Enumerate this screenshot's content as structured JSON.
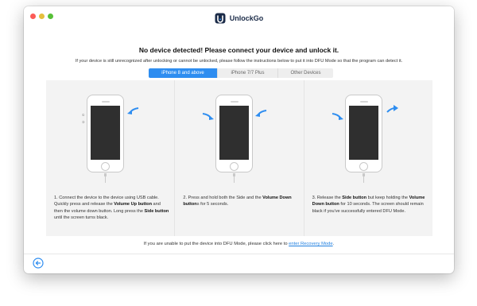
{
  "app": {
    "name": "UnlockGo"
  },
  "colors": {
    "accent": "#2e8df0",
    "link": "#1f7fe0",
    "arrow": "#2e8df0",
    "screen": "#2f2f2f"
  },
  "headline": "No device detected! Please connect your device and unlock it.",
  "subline": "If your device is still unrecognized after unlocking or cannot be unlocked, please follow the instructions below to put it into DFU Mode so that the program can detect it.",
  "tabs": [
    {
      "label": "iPhone 8 and above",
      "active": true
    },
    {
      "label": "iPhone 7/7 Plus",
      "active": false
    },
    {
      "label": "Other Devices",
      "active": false
    }
  ],
  "steps": [
    {
      "side_labels": [
        "①",
        "②"
      ],
      "arrows": [
        "right-arrow-icon"
      ],
      "parts": [
        {
          "t": "1. Connect the device to the device using USB cable. Quickly press and release the ",
          "b": false
        },
        {
          "t": "Volume Up button",
          "b": true
        },
        {
          "t": " and then the volume down button. Long press the ",
          "b": false
        },
        {
          "t": "Side button",
          "b": true
        },
        {
          "t": " until the screen turns black.",
          "b": false
        }
      ]
    },
    {
      "arrows": [
        "left-arrow-icon",
        "right-arrow-icon"
      ],
      "parts": [
        {
          "t": "2. Press and hold both the Side and the ",
          "b": false
        },
        {
          "t": "Volume Down button",
          "b": true
        },
        {
          "t": "s for 5 seconds.",
          "b": false
        }
      ]
    },
    {
      "arrows": [
        "left-arrow-icon",
        "release-arrow-icon"
      ],
      "parts": [
        {
          "t": "3. Release the ",
          "b": false
        },
        {
          "t": "Side button",
          "b": true
        },
        {
          "t": " but keep holding the ",
          "b": false
        },
        {
          "t": "Volume Down button",
          "b": true
        },
        {
          "t": " for 10 seconds. The screen should remain black if you've successfully entered DFU Mode.",
          "b": false
        }
      ]
    }
  ],
  "footer": {
    "text": "If you are unable to put the device into DFU Mode, please click here to ",
    "link": "enter Recovery Mode",
    "end": "."
  }
}
